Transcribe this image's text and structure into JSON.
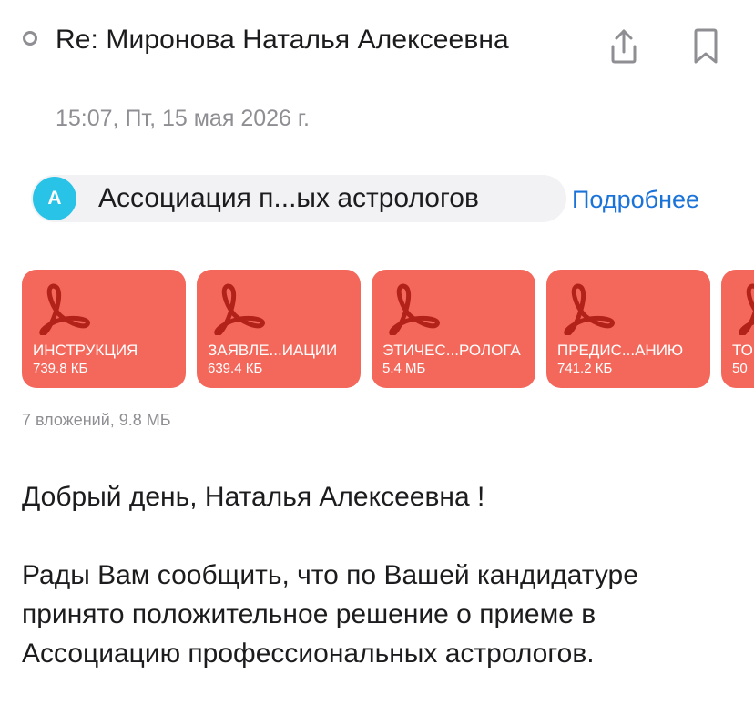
{
  "header": {
    "subject": "Re: Миронова Наталья Алексеевна",
    "date": "15:07, Пт, 15 мая 2026 г.",
    "share_icon": "share-icon",
    "bookmark_icon": "bookmark-icon"
  },
  "sender": {
    "avatar_letter": "A",
    "avatar_color": "#29c3e8",
    "name": "Ассоциация п...ых астрологов",
    "details_label": "Подробнее"
  },
  "attachments": {
    "items": [
      {
        "name": "ИНСТРУКЦИЯ",
        "size": "739.8 КБ",
        "icon": "pdf-icon"
      },
      {
        "name": "ЗАЯВЛЕ...ИАЦИИ",
        "size": "639.4 КБ",
        "icon": "pdf-icon"
      },
      {
        "name": "ЭТИЧЕС...РОЛОГА",
        "size": "5.4 МБ",
        "icon": "pdf-icon"
      },
      {
        "name": "ПРЕДИС...АНИЮ",
        "size": "741.2 КБ",
        "icon": "pdf-icon"
      },
      {
        "name": "ТО",
        "size": "50",
        "icon": "pdf-icon"
      }
    ],
    "summary": "7 вложений, 9.8 МБ",
    "tile_color": "#f4685c"
  },
  "body": {
    "greeting": "Добрый день, Наталья Алексеевна !",
    "message": "Рады Вам сообщить, что по Вашей кандидатуре принято положительное решение о приеме в Ассоциацию профессиональных астрологов."
  },
  "colors": {
    "link": "#1a73d9",
    "secondary_text": "#8e8e93"
  }
}
